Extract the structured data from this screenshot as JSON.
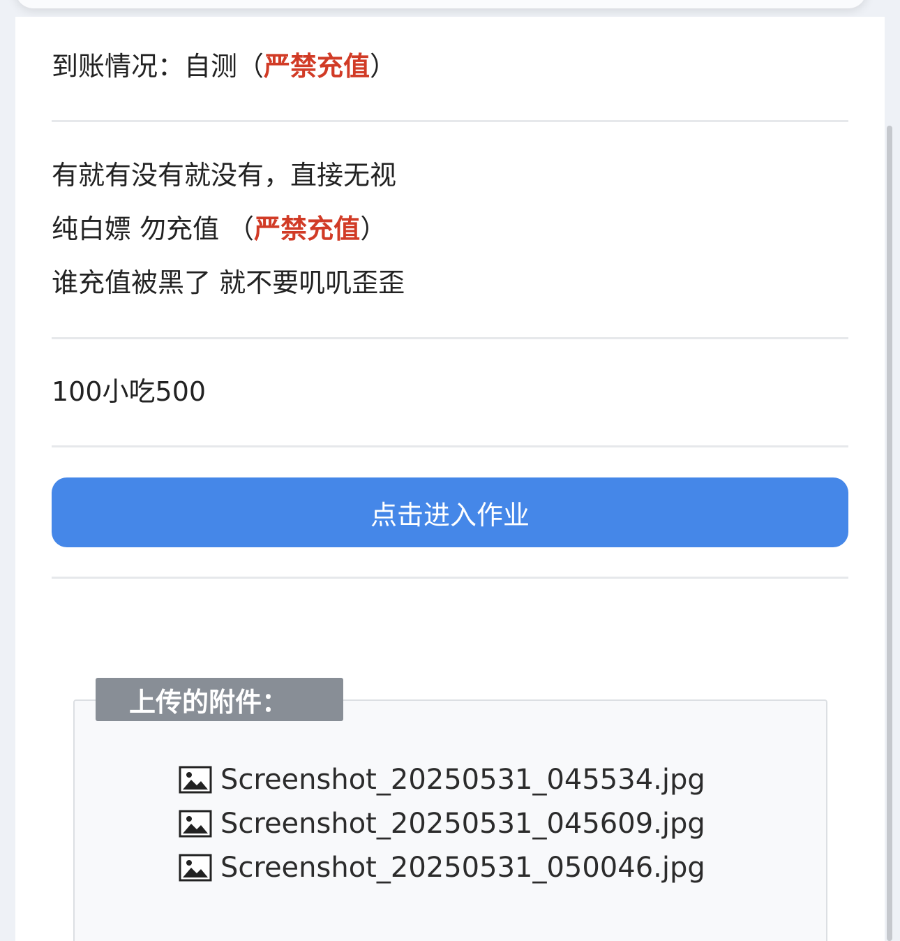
{
  "arrival": {
    "prefix": "到账情况：自测（",
    "highlight": "严禁充值",
    "suffix": "）"
  },
  "notes": {
    "line1": "有就有没有就没有，直接无视",
    "line2_prefix": "纯白嫖 勿充值 （",
    "line2_highlight": "严禁充值",
    "line2_suffix": "）",
    "line3": "谁充值被黑了 就不要叽叽歪歪"
  },
  "offer": "100小吃500",
  "enter_button": "点击进入作业",
  "attachments": {
    "legend": "上传的附件：",
    "files": [
      "Screenshot_20250531_045534.jpg",
      "Screenshot_20250531_045609.jpg",
      "Screenshot_20250531_050046.jpg"
    ],
    "file_icon": "image-file-icon"
  },
  "colors": {
    "accent_button": "#4587e8",
    "warning_red": "#d13b26",
    "legend_bg": "#888e96"
  }
}
